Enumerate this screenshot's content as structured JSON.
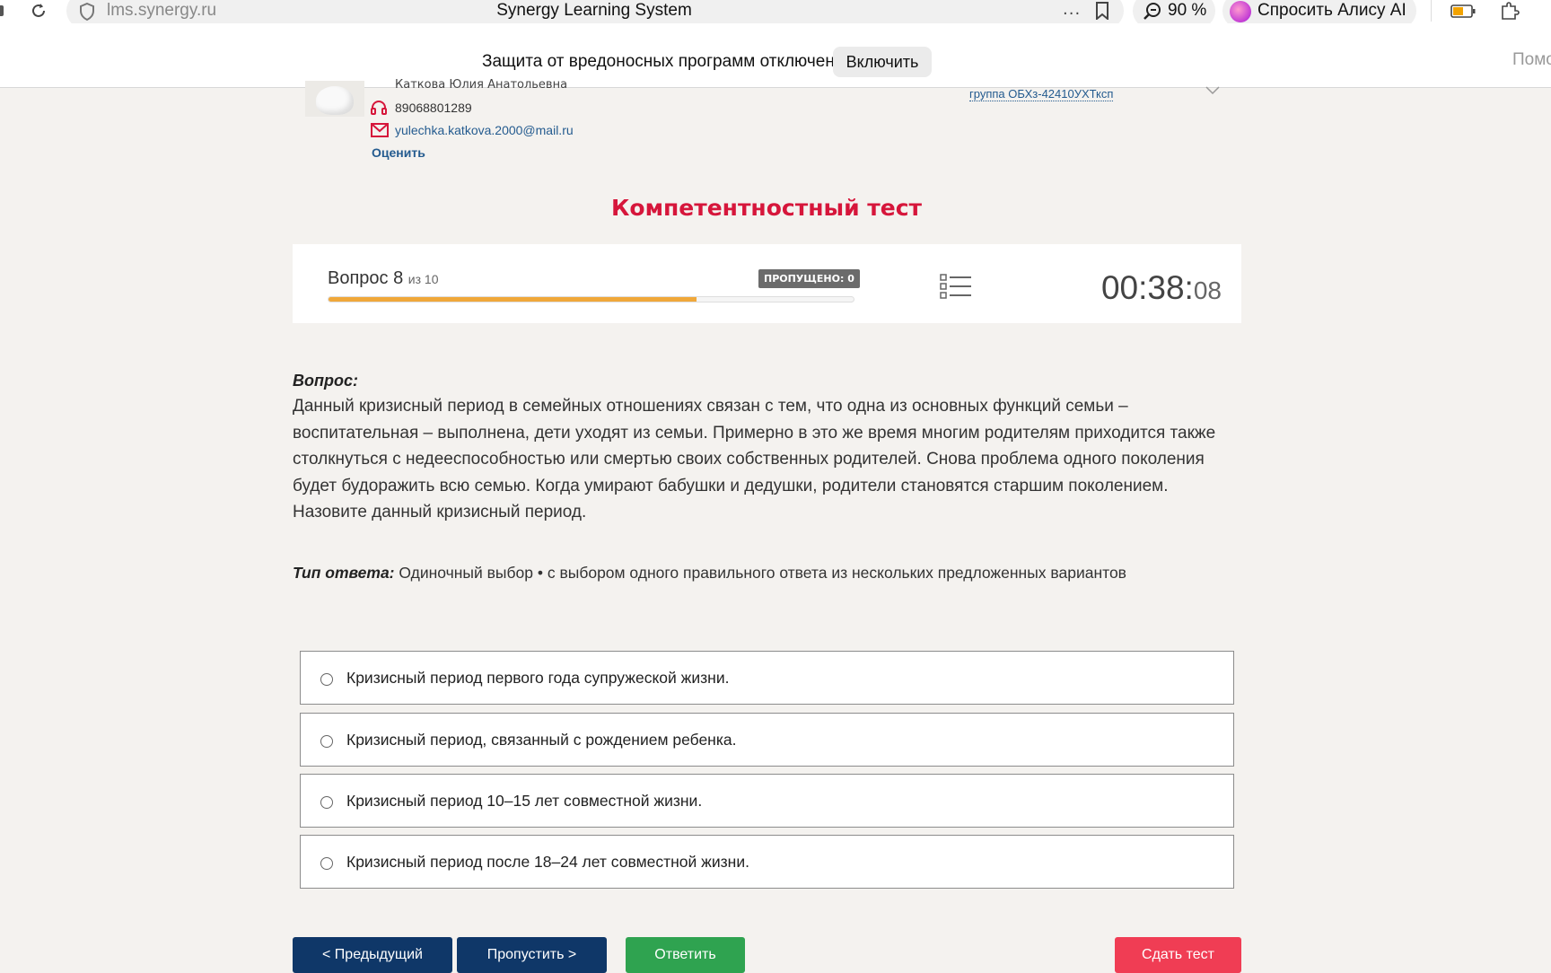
{
  "browser": {
    "url": "lms.synergy.ru",
    "tab_title": "Synergy Learning System",
    "more": "···",
    "zoom": "90 %",
    "alice_label": "Спросить Алису AI"
  },
  "security_bar": {
    "message": "Защита от вредоносных программ отключена",
    "enable_label": "Включить",
    "help_label": "Помо"
  },
  "curator": {
    "name": "Каткова Юлия Анатольевна",
    "phone": "89068801289",
    "email": "yulechka.katkova.2000@mail.ru",
    "rate_label": "Оценить",
    "group": "группа ОБХз-42410УХТксп"
  },
  "test": {
    "title": "Компетентностный тест",
    "question_word": "Вопрос",
    "question_number": "8",
    "question_of": "из 10",
    "progress_fraction": 0.7,
    "skipped_label": "ПРОПУЩЕНО: 0",
    "timer_main": "00:38:",
    "timer_seconds": "08"
  },
  "question": {
    "label": "Вопрос:",
    "text": "Данный кризисный период в семейных отношениях связан с тем, что одна из основных функций семьи – воспитательная – выполнена, дети уходят из семьи. Примерно в это же время многим родителям приходится также столкнуться с недееспособностью или смертью своих собственных родителей. Снова проблема одного поколения будет будоражить всю семью. Когда умирают бабушки и дедушки, родители становятся старшим поколением. Назовите данный кризисный период.",
    "answer_type_label": "Тип ответа:",
    "answer_type_value": "Одиночный выбор • с выбором одного правильного ответа из нескольких предложенных вариантов"
  },
  "options": [
    "Кризисный период первого года супружеской жизни.",
    "Кризисный период, связанный с рождением ребенка.",
    "Кризисный период 10–15 лет совместной жизни.",
    "Кризисный период после 18–24 лет совместной жизни."
  ],
  "buttons": {
    "prev": "< Предыдущий",
    "skip": "Пропустить >",
    "answer": "Ответить",
    "submit": "Сдать тест"
  },
  "colors": {
    "accent_title": "#d6163b",
    "progress": "#f0a83a",
    "nav_button": "#0f3768",
    "answer_button": "#2fa350",
    "submit_button": "#f03d54"
  }
}
